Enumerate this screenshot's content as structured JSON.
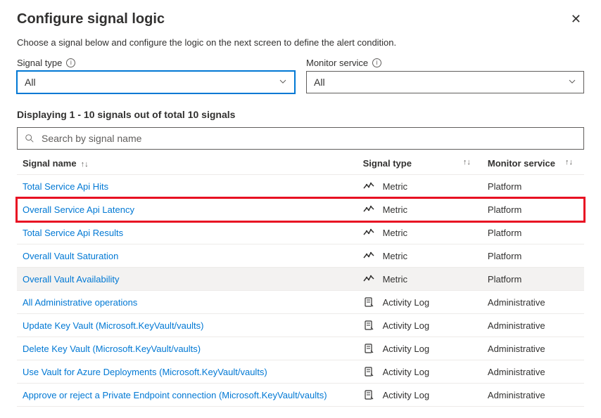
{
  "header": {
    "title": "Configure signal logic",
    "subtitle": "Choose a signal below and configure the logic on the next screen to define the alert condition."
  },
  "filters": {
    "signal_type": {
      "label": "Signal type",
      "value": "All"
    },
    "monitor_service": {
      "label": "Monitor service",
      "value": "All"
    }
  },
  "count_text": "Displaying 1 - 10 signals out of total 10 signals",
  "search": {
    "placeholder": "Search by signal name"
  },
  "columns": {
    "name": "Signal name",
    "type": "Signal type",
    "monitor": "Monitor service"
  },
  "rows": [
    {
      "name": "Total Service Api Hits",
      "type": "Metric",
      "monitor": "Platform",
      "icon": "metric",
      "highlighted": false,
      "hover": false
    },
    {
      "name": "Overall Service Api Latency",
      "type": "Metric",
      "monitor": "Platform",
      "icon": "metric",
      "highlighted": true,
      "hover": false
    },
    {
      "name": "Total Service Api Results",
      "type": "Metric",
      "monitor": "Platform",
      "icon": "metric",
      "highlighted": false,
      "hover": false
    },
    {
      "name": "Overall Vault Saturation",
      "type": "Metric",
      "monitor": "Platform",
      "icon": "metric",
      "highlighted": false,
      "hover": false
    },
    {
      "name": "Overall Vault Availability",
      "type": "Metric",
      "monitor": "Platform",
      "icon": "metric",
      "highlighted": false,
      "hover": true
    },
    {
      "name": "All Administrative operations",
      "type": "Activity Log",
      "monitor": "Administrative",
      "icon": "activity",
      "highlighted": false,
      "hover": false
    },
    {
      "name": "Update Key Vault (Microsoft.KeyVault/vaults)",
      "type": "Activity Log",
      "monitor": "Administrative",
      "icon": "activity",
      "highlighted": false,
      "hover": false
    },
    {
      "name": "Delete Key Vault (Microsoft.KeyVault/vaults)",
      "type": "Activity Log",
      "monitor": "Administrative",
      "icon": "activity",
      "highlighted": false,
      "hover": false
    },
    {
      "name": "Use Vault for Azure Deployments (Microsoft.KeyVault/vaults)",
      "type": "Activity Log",
      "monitor": "Administrative",
      "icon": "activity",
      "highlighted": false,
      "hover": false
    },
    {
      "name": "Approve or reject a Private Endpoint connection (Microsoft.KeyVault/vaults)",
      "type": "Activity Log",
      "monitor": "Administrative",
      "icon": "activity",
      "highlighted": false,
      "hover": false
    }
  ]
}
